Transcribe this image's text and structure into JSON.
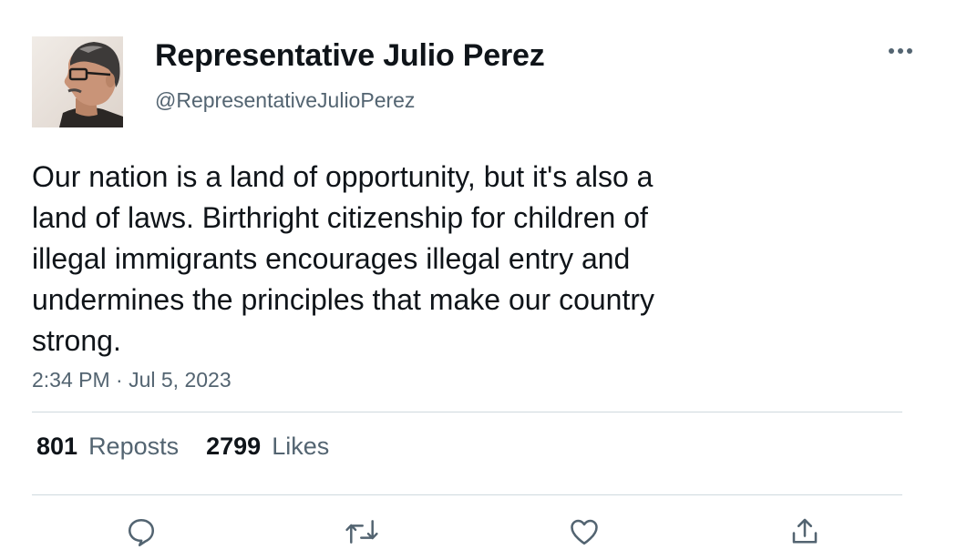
{
  "author": {
    "display_name": "Representative Julio Perez",
    "handle": "@RepresentativeJulioPerez",
    "avatar_icon": "profile-photo"
  },
  "tweet": {
    "text": "Our nation is a land of opportunity, but it's also a\nland of laws. Birthright citizenship for children of\nillegal immigrants encourages illegal entry and\nundermines the principles that make our country\nstrong.",
    "timestamp": "2:34 PM · Jul 5, 2023"
  },
  "stats": {
    "reposts_count": "801",
    "reposts_label": "Reposts",
    "likes_count": "2799",
    "likes_label": "Likes"
  },
  "actions": [
    {
      "name": "reply",
      "icon": "reply-icon"
    },
    {
      "name": "repost",
      "icon": "repost-icon"
    },
    {
      "name": "like",
      "icon": "heart-icon"
    },
    {
      "name": "share",
      "icon": "share-icon"
    }
  ],
  "colors": {
    "text": "#0f1419",
    "secondary": "#536471",
    "divider": "#cfd9de"
  }
}
